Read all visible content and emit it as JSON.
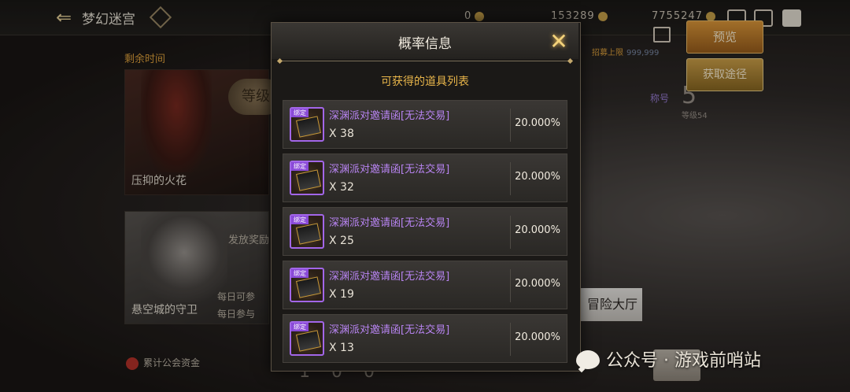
{
  "topbar": {
    "back_icon": "arrow-left-icon",
    "title": "梦幻迷宫",
    "currency_1": "0",
    "currency_2": "153289",
    "currency_3": "7755247"
  },
  "left_panel": {
    "timer_label": "剩余时间",
    "card1_name": "压抑的火花",
    "level_label": "等级",
    "card2_name": "悬空城的守卫",
    "feature_label": "发放奖励",
    "daily_1": "每日可参",
    "daily_2": "每日参与",
    "guild_label": "累计公会资金",
    "bottom_digits": "1 0 0"
  },
  "right_panel": {
    "recruit_label": "招募上限",
    "recruit_value": "999,999",
    "rank_label": "称号",
    "rank_value": "5",
    "rank_sub": "等级54",
    "preview_label": "预览",
    "obtain_label": "获取途径",
    "hall_label": "冒险大厅"
  },
  "modal": {
    "title": "概率信息",
    "close_icon": "close-x-icon",
    "subtitle": "可获得的道具列表",
    "bind_tag": "绑定",
    "items": [
      {
        "name": "深渊派对邀请函[无法交易]",
        "qty": "X 38",
        "rate": "20.000%"
      },
      {
        "name": "深渊派对邀请函[无法交易]",
        "qty": "X 32",
        "rate": "20.000%"
      },
      {
        "name": "深渊派对邀请函[无法交易]",
        "qty": "X 25",
        "rate": "20.000%"
      },
      {
        "name": "深渊派对邀请函[无法交易]",
        "qty": "X 19",
        "rate": "20.000%"
      },
      {
        "name": "深渊派对邀请函[无法交易]",
        "qty": "X 13",
        "rate": "20.000%"
      }
    ]
  },
  "watermark": {
    "text": "公众号 · 游戏前哨站",
    "icon": "wechat-icon"
  },
  "colors": {
    "item_name": "#b884f2",
    "subtitle": "#e8b54a",
    "preview_button": "#e09a3a"
  }
}
